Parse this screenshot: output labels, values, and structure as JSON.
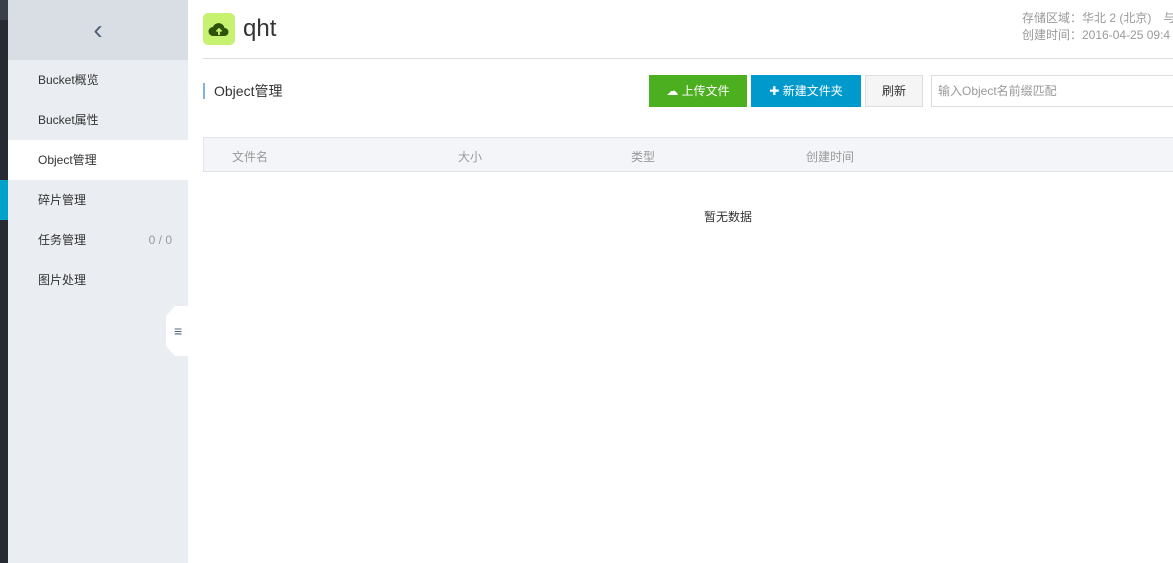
{
  "sidebar": {
    "items": [
      {
        "label": "Bucket概览"
      },
      {
        "label": "Bucket属性"
      },
      {
        "label": "Object管理",
        "active": true
      },
      {
        "label": "碎片管理"
      },
      {
        "label": "任务管理",
        "count": "0 / 0"
      },
      {
        "label": "图片处理"
      }
    ]
  },
  "header": {
    "bucket_name": "qht",
    "region": "存储区域：华北 2 (北京)　与",
    "created": "创建时间：2016-04-25 09:4"
  },
  "section": {
    "title": "Object管理"
  },
  "toolbar": {
    "upload": "上传文件",
    "new_folder": "新建文件夹",
    "refresh": "刷新",
    "search_placeholder": "输入Object名前缀匹配"
  },
  "table": {
    "columns": [
      "文件名",
      "大小",
      "类型",
      "创建时间"
    ],
    "empty": "暂无数据"
  },
  "colors": {
    "upload": "#4caf1f",
    "new_folder": "#0099cc",
    "accent": "#00a2ca"
  }
}
